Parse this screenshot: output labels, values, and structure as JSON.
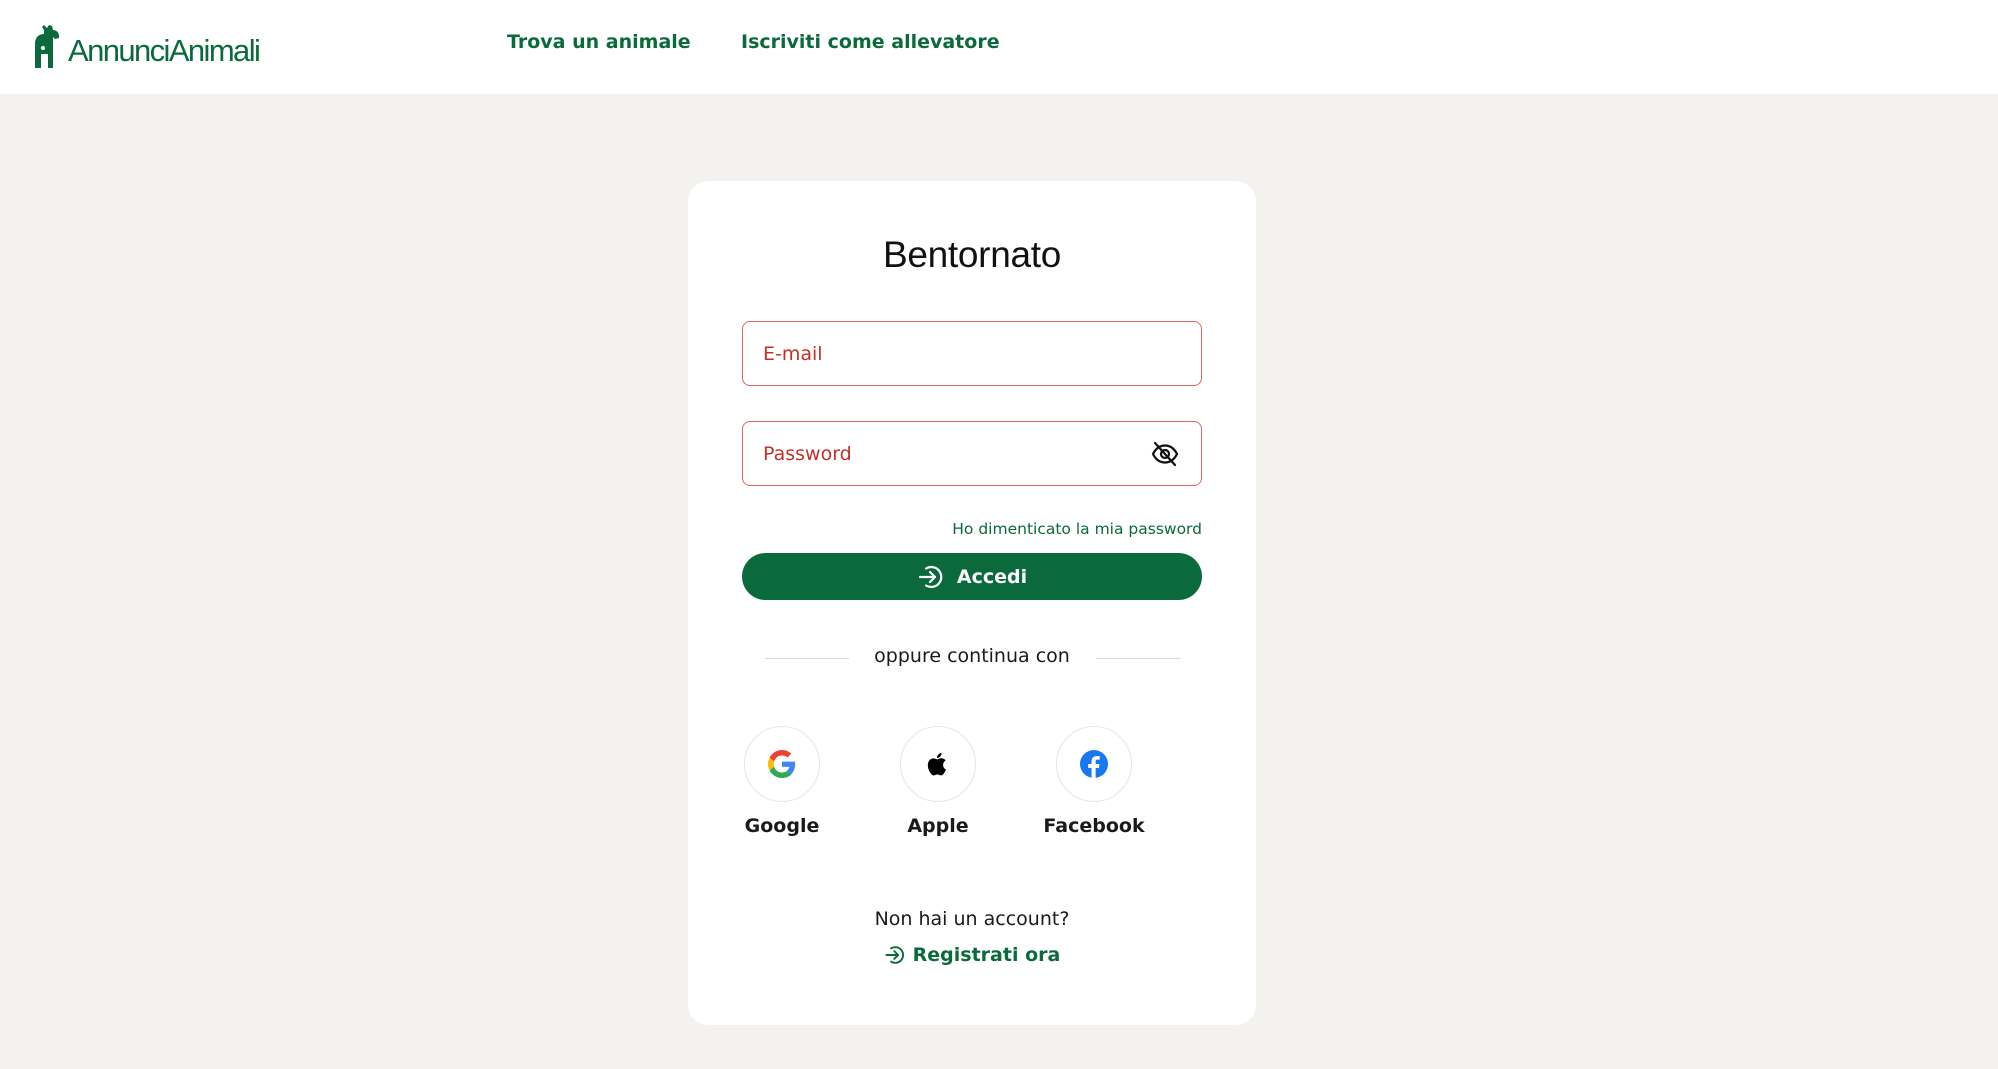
{
  "header": {
    "logo_text": "AnnunciAnimali",
    "nav": {
      "find_animal": "Trova un animale",
      "register_breeder": "Iscriviti come allevatore"
    }
  },
  "login": {
    "title": "Bentornato",
    "email_placeholder": "E-mail",
    "password_placeholder": "Password",
    "forgot_password": "Ho dimenticato la mia password",
    "submit_label": "Accedi",
    "divider_text": "oppure continua con",
    "social": {
      "google": "Google",
      "apple": "Apple",
      "facebook": "Facebook"
    },
    "no_account_text": "Non hai un account?",
    "register_label": "Registrati ora"
  },
  "icons": {
    "logo": "giraffe-logo-icon",
    "password_toggle": "eye-off-icon",
    "submit": "arrow-right-circle-icon",
    "google": "google-icon",
    "apple": "apple-icon",
    "facebook": "facebook-icon",
    "register": "arrow-right-circle-icon"
  },
  "colors": {
    "brand_green": "#0b6a3c",
    "error_red": "#c0312a",
    "error_border": "#e0645f",
    "page_background": "#f3f2ef",
    "card_background": "#ffffff",
    "facebook_blue": "#1877f2"
  }
}
